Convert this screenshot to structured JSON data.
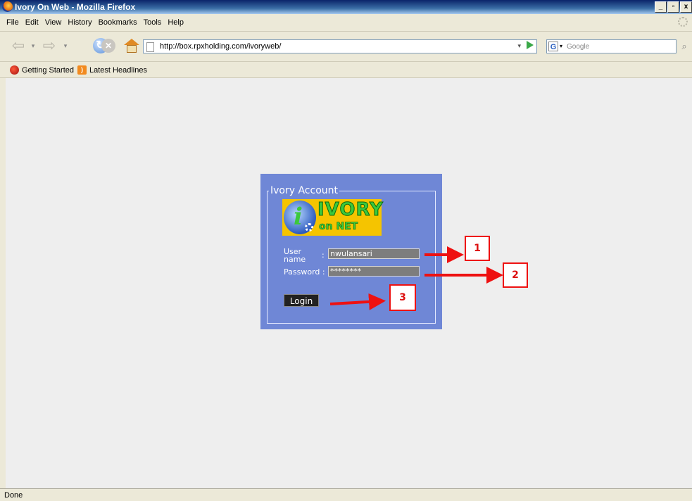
{
  "window": {
    "title": "Ivory On Web - Mozilla Firefox",
    "controls": [
      "_",
      "▫",
      "x"
    ]
  },
  "menu": [
    "File",
    "Edit",
    "View",
    "History",
    "Bookmarks",
    "Tools",
    "Help"
  ],
  "nav": {
    "url": "http://box.rpxholding.com/ivoryweb/",
    "search_engine_letter": "G",
    "search_placeholder": "Google"
  },
  "bookmarks": [
    {
      "label": "Getting Started",
      "icon": "firefox-icon"
    },
    {
      "label": "Latest Headlines",
      "icon": "rss-icon"
    }
  ],
  "login": {
    "legend": "Ivory Account",
    "logo": {
      "line1": "IVORY",
      "line2": "on NET",
      "letter": "i"
    },
    "username_label_1": "User",
    "username_label_2": "name",
    "username_colon": ":",
    "username_value": "nwulansari",
    "password_label": "Password :",
    "password_value": "********",
    "login_button": "Login"
  },
  "annotations": {
    "marker1": "1",
    "marker2": "2",
    "marker3": "3",
    "color": "#ee1111"
  },
  "status": "Done"
}
